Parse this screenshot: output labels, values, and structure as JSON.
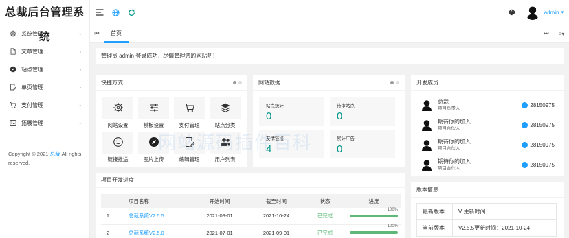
{
  "app": {
    "title": "总裁后台管理系统"
  },
  "sidebar": {
    "items": [
      {
        "label": "系统管理",
        "icon": "gear-icon"
      },
      {
        "label": "文章管理",
        "icon": "document-icon"
      },
      {
        "label": "站点管理",
        "icon": "compass-icon"
      },
      {
        "label": "单页管理",
        "icon": "edit-page-icon"
      },
      {
        "label": "支付管理",
        "icon": "cart-icon"
      },
      {
        "label": "拓展管理",
        "icon": "extension-icon"
      }
    ],
    "arrow": "›",
    "copyright": {
      "prefix": "Copyright © 2021",
      "link": "总裁",
      "suffix": "All rights reserved."
    }
  },
  "header": {
    "user_name": "admin",
    "caret": "▾",
    "accent_color": "#1e9fff"
  },
  "tabs": {
    "prev": "⏮",
    "home": "首页",
    "next": "⏭",
    "menu": "≡▾"
  },
  "welcome": {
    "text": "管理员 admin 登录成功，尽情管理您的网站吧！"
  },
  "quick": {
    "title": "快捷方式",
    "items": [
      {
        "label": "网站设置",
        "icon": "gear-icon"
      },
      {
        "label": "模板设置",
        "icon": "sliders-icon"
      },
      {
        "label": "支付管理",
        "icon": "cart-icon"
      },
      {
        "label": "站点分类",
        "icon": "layers-icon"
      },
      {
        "label": "链接推送",
        "icon": "smile-icon"
      },
      {
        "label": "图片上传",
        "icon": "compass-icon"
      },
      {
        "label": "编辑管理",
        "icon": "edit-page-icon"
      },
      {
        "label": "用户列表",
        "icon": "users-icon"
      }
    ]
  },
  "stats": {
    "title": "网站数据",
    "items": [
      {
        "label": "站点统计",
        "value": "0"
      },
      {
        "label": "待审站点",
        "value": "0"
      },
      {
        "label": "友情链接",
        "value": "4"
      },
      {
        "label": "累计广告",
        "value": "0"
      }
    ],
    "value_color": "#009688"
  },
  "members": {
    "title": "开发成员",
    "items": [
      {
        "name": "总裁",
        "role": "项目负责人",
        "qq": "28150975"
      },
      {
        "name": "期待你的加入",
        "role": "项目合伙人",
        "qq": "28150975"
      },
      {
        "name": "期待你的加入",
        "role": "项目合伙人",
        "qq": "28150975"
      },
      {
        "name": "期待你的加入",
        "role": "项目合伙人",
        "qq": "28150975"
      }
    ]
  },
  "progress": {
    "title": "项目开发进度",
    "columns": [
      "",
      "项目名称",
      "开始时间",
      "截至时间",
      "状态",
      "进度"
    ],
    "rows": [
      {
        "num": "1",
        "name": "总裁系统V2.5.5",
        "start": "2021-09-01",
        "end": "2021-10-24",
        "status": "已完成",
        "pct_label": "100%",
        "pct": 1.0
      },
      {
        "num": "2",
        "name": "总裁系统V2.5.0",
        "start": "2021-07-01",
        "end": "2021-09-01",
        "status": "已完成",
        "pct_label": "100%",
        "pct": 1.0
      }
    ]
  },
  "version": {
    "title": "版本信息",
    "rows": [
      {
        "key": "最新版本",
        "value": "V 更新时间："
      },
      {
        "key": "当前版本",
        "value": "V2.5.5更新时间：2021-10-24"
      }
    ]
  },
  "watermark": {
    "text": "网站源码插件百科"
  }
}
